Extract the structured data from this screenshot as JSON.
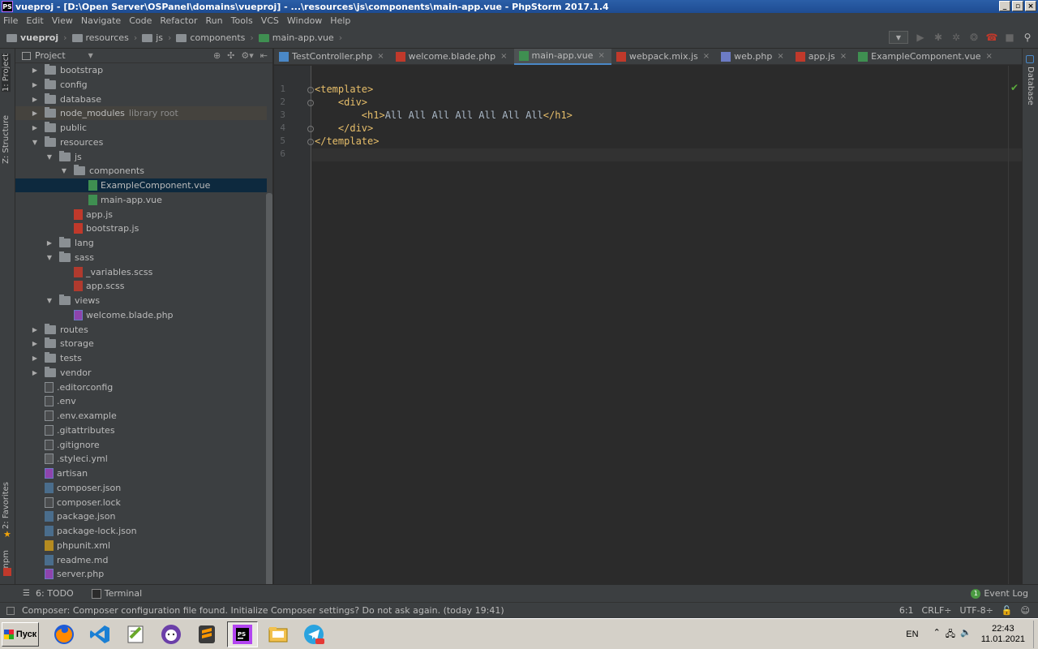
{
  "window": {
    "title": "vueproj - [D:\\Open Server\\OSPanel\\domains\\vueproj] - ...\\resources\\js\\components\\main-app.vue - PhpStorm 2017.1.4",
    "logo_text": "PS"
  },
  "menu": [
    "File",
    "Edit",
    "View",
    "Navigate",
    "Code",
    "Refactor",
    "Run",
    "Tools",
    "VCS",
    "Window",
    "Help"
  ],
  "breadcrumbs": [
    "vueproj",
    "resources",
    "js",
    "components",
    "main-app.vue"
  ],
  "left_strip": {
    "project_tab": "1: Project",
    "structure_tab": "Z: Structure",
    "favorites_tab": "2: Favorites",
    "npm_tab": "npm"
  },
  "project_panel": {
    "title": "Project",
    "tree": [
      {
        "label": "bootstrap",
        "type": "folder",
        "depth": 0,
        "arrow": "right"
      },
      {
        "label": "config",
        "type": "folder",
        "depth": 0,
        "arrow": "right"
      },
      {
        "label": "database",
        "type": "folder",
        "depth": 0,
        "arrow": "right"
      },
      {
        "label": "node_modules",
        "type": "folder",
        "depth": 0,
        "arrow": "right",
        "hint": "library root"
      },
      {
        "label": "public",
        "type": "folder",
        "depth": 0,
        "arrow": "right"
      },
      {
        "label": "resources",
        "type": "folder",
        "depth": 0,
        "arrow": "down"
      },
      {
        "label": "js",
        "type": "folder",
        "depth": 1,
        "arrow": "down"
      },
      {
        "label": "components",
        "type": "folder",
        "depth": 2,
        "arrow": "down"
      },
      {
        "label": "ExampleComponent.vue",
        "type": "vue",
        "depth": 3,
        "selected": true
      },
      {
        "label": "main-app.vue",
        "type": "vue",
        "depth": 3
      },
      {
        "label": "app.js",
        "type": "js",
        "depth": 2
      },
      {
        "label": "bootstrap.js",
        "type": "js",
        "depth": 2
      },
      {
        "label": "lang",
        "type": "folder",
        "depth": 1,
        "arrow": "right"
      },
      {
        "label": "sass",
        "type": "folder",
        "depth": 1,
        "arrow": "down"
      },
      {
        "label": "_variables.scss",
        "type": "scss",
        "depth": 2
      },
      {
        "label": "app.scss",
        "type": "scss",
        "depth": 2
      },
      {
        "label": "views",
        "type": "folder",
        "depth": 1,
        "arrow": "down"
      },
      {
        "label": "welcome.blade.php",
        "type": "php",
        "depth": 2
      },
      {
        "label": "routes",
        "type": "folder",
        "depth": 0,
        "arrow": "right"
      },
      {
        "label": "storage",
        "type": "folder",
        "depth": 0,
        "arrow": "right"
      },
      {
        "label": "tests",
        "type": "folder",
        "depth": 0,
        "arrow": "right"
      },
      {
        "label": "vendor",
        "type": "folder",
        "depth": 0,
        "arrow": "right"
      },
      {
        "label": ".editorconfig",
        "type": "plain",
        "depth": 0
      },
      {
        "label": ".env",
        "type": "plain",
        "depth": 0
      },
      {
        "label": ".env.example",
        "type": "plain",
        "depth": 0
      },
      {
        "label": ".gitattributes",
        "type": "plain",
        "depth": 0
      },
      {
        "label": ".gitignore",
        "type": "plain",
        "depth": 0
      },
      {
        "label": ".styleci.yml",
        "type": "yml",
        "depth": 0
      },
      {
        "label": "artisan",
        "type": "php",
        "depth": 0
      },
      {
        "label": "composer.json",
        "type": "json",
        "depth": 0
      },
      {
        "label": "composer.lock",
        "type": "plain",
        "depth": 0
      },
      {
        "label": "package.json",
        "type": "json",
        "depth": 0
      },
      {
        "label": "package-lock.json",
        "type": "json",
        "depth": 0
      },
      {
        "label": "phpunit.xml",
        "type": "xml",
        "depth": 0
      },
      {
        "label": "readme.md",
        "type": "md",
        "depth": 0
      },
      {
        "label": "server.php",
        "type": "php",
        "depth": 0
      }
    ]
  },
  "tabs": [
    {
      "label": "TestController.php",
      "icon": "#4a88c7"
    },
    {
      "label": "welcome.blade.php",
      "icon": "#c0392b"
    },
    {
      "label": "main-app.vue",
      "icon": "#3f8f51",
      "active": true
    },
    {
      "label": "webpack.mix.js",
      "icon": "#c0392b"
    },
    {
      "label": "web.php",
      "icon": "#6c7bc4"
    },
    {
      "label": "app.js",
      "icon": "#c0392b"
    },
    {
      "label": "ExampleComponent.vue",
      "icon": "#3f8f51"
    }
  ],
  "editor": {
    "line_numbers": [
      "1",
      "2",
      "3",
      "4",
      "5",
      "6"
    ],
    "lines": [
      {
        "indent": "",
        "open": "<template>",
        "text": "",
        "close": ""
      },
      {
        "indent": "    ",
        "open": "<div>",
        "text": "",
        "close": ""
      },
      {
        "indent": "        ",
        "open": "<h1>",
        "text": "All All All All All All All",
        "close": "</h1>"
      },
      {
        "indent": "    ",
        "open": "</div>",
        "text": "",
        "close": ""
      },
      {
        "indent": "",
        "open": "</template>",
        "text": "",
        "close": ""
      },
      {
        "indent": "",
        "open": "",
        "text": "",
        "close": ""
      }
    ]
  },
  "right_strip": {
    "database_tab": "Database"
  },
  "bottom_tools": {
    "todo": "6: TODO",
    "terminal": "Terminal",
    "event_log": "Event Log",
    "event_count": "1"
  },
  "status": {
    "message": "Composer: Composer configuration file found. Initialize Composer settings? Do not ask again. (today 19:41)",
    "position": "6:1",
    "line_sep": "CRLF÷",
    "encoding": "UTF-8÷"
  },
  "taskbar": {
    "start_label": "Пуск",
    "lang": "EN",
    "time": "22:43",
    "date": "11.01.2021"
  }
}
